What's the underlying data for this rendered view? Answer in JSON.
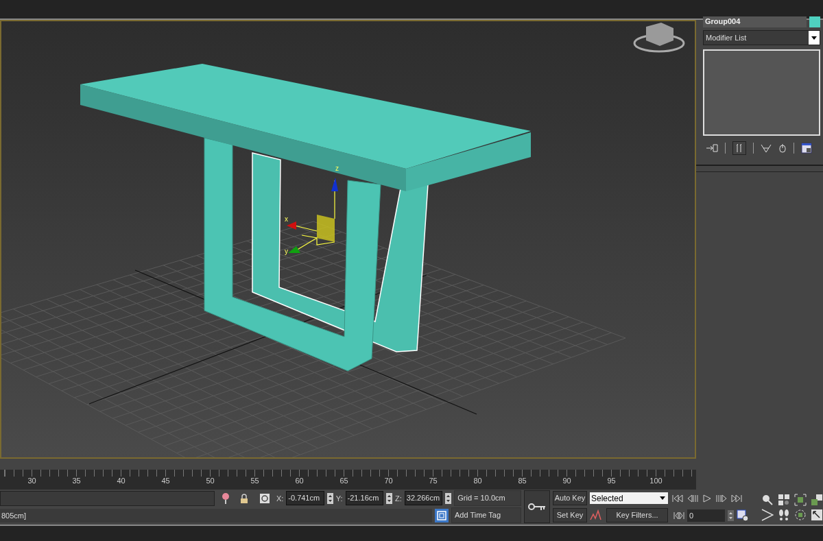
{
  "viewport": {
    "gizmo_axes": [
      {
        "axis": "x"
      },
      {
        "axis": "y"
      },
      {
        "axis": "z"
      }
    ]
  },
  "command_panel": {
    "object_name": "Group004",
    "modifier_list": "Modifier List"
  },
  "timeline": {
    "ticks": [
      "30",
      "35",
      "40",
      "45",
      "50",
      "55",
      "60",
      "65",
      "70",
      "75",
      "80",
      "85",
      "90",
      "95",
      "100"
    ]
  },
  "status": {
    "prompt": "805cm]",
    "coords": [
      {
        "axis": "X:",
        "value": "-0.741cm"
      },
      {
        "axis": "Y:",
        "value": "-21.16cm"
      },
      {
        "axis": "Z:",
        "value": "32.266cm"
      }
    ],
    "grid": "Grid = 10.0cm",
    "add_time_tag": "Add Time Tag",
    "auto_key": "Auto Key",
    "set_key": "Set Key",
    "key_mode": "Selected",
    "key_filters": "Key Filters...",
    "frame": "0"
  }
}
